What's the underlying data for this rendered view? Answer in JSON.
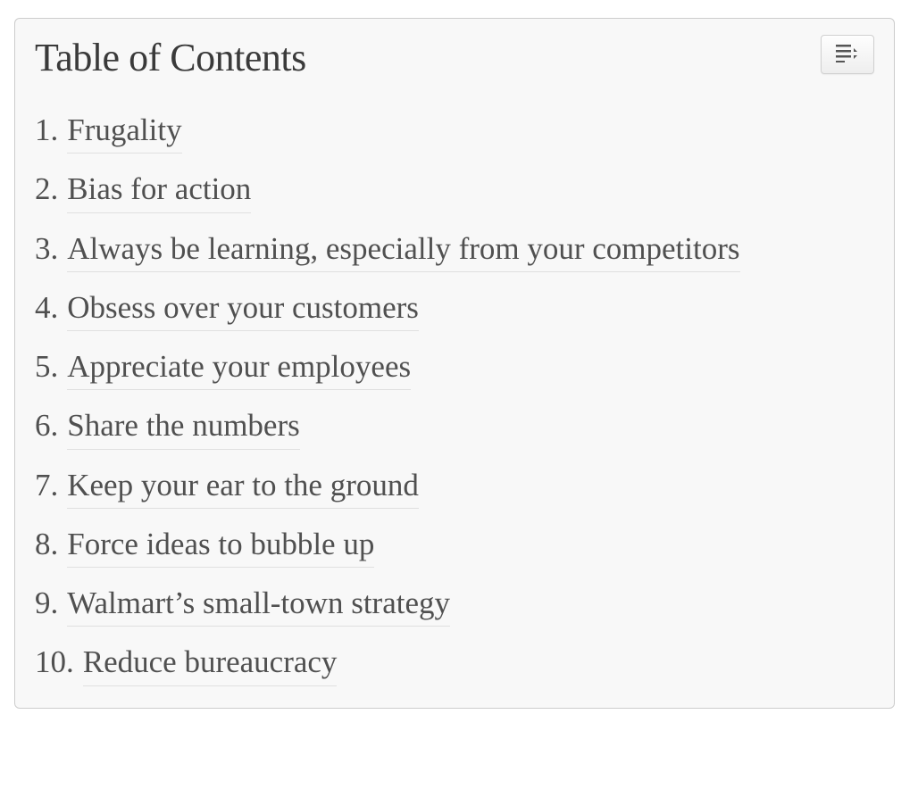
{
  "toc": {
    "title": "Table of Contents",
    "toggle_icon": "toc-toggle-icon",
    "items": [
      {
        "num": "1.",
        "label": "Frugality"
      },
      {
        "num": "2.",
        "label": "Bias for action"
      },
      {
        "num": "3.",
        "label": "Always be learning, especially from your competitors"
      },
      {
        "num": "4.",
        "label": "Obsess over your customers"
      },
      {
        "num": "5.",
        "label": "Appreciate your employees"
      },
      {
        "num": "6.",
        "label": "Share the numbers"
      },
      {
        "num": "7.",
        "label": "Keep your ear to the ground"
      },
      {
        "num": "8.",
        "label": "Force ideas to bubble up"
      },
      {
        "num": "9.",
        "label": "Walmart’s small-town strategy"
      },
      {
        "num": "10.",
        "label": "Reduce bureaucracy"
      }
    ]
  }
}
